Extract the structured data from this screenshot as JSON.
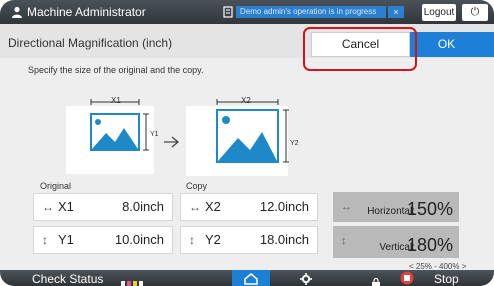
{
  "topbar": {
    "user_icon": "user-icon",
    "title": "Machine Administrator",
    "notice_icon": "document-icon",
    "notice_text": "Demo admin's operation is in progress",
    "notice_close": "×",
    "logout_label": "Logout",
    "power_icon": "power-icon",
    "power_glyph": "⏻"
  },
  "header": {
    "title": "Directional Magnification (inch)",
    "cancel_label": "Cancel",
    "ok_label": "OK"
  },
  "instruction": "Specify the size of the original and the copy.",
  "diagram": {
    "orig_x_label": "X1",
    "orig_y_label": "Y1",
    "copy_x_label": "X2",
    "copy_y_label": "Y2",
    "arrow": "→"
  },
  "original": {
    "label": "Original",
    "x": {
      "icon": "↔",
      "name": "X1",
      "value": "8.0inch"
    },
    "y": {
      "icon": "↕",
      "name": "Y1",
      "value": "10.0inch"
    }
  },
  "copy": {
    "label": "Copy",
    "x": {
      "icon": "↔",
      "name": "X2",
      "value": "12.0inch"
    },
    "y": {
      "icon": "↕",
      "name": "Y2",
      "value": "18.0inch"
    }
  },
  "magnification": {
    "horizontal": {
      "icon": "↔",
      "label": "Horizontal:",
      "value": "150%"
    },
    "vertical": {
      "icon": "↕",
      "label": "Vertical:",
      "value": "180%"
    },
    "range": "< 25% - 400% >"
  },
  "bottom": {
    "check_status": "Check Status",
    "stop": "Stop"
  },
  "colors": {
    "accent": "#1e7fd6",
    "highlight": "#d0161c",
    "topbar": "#3a4147"
  }
}
